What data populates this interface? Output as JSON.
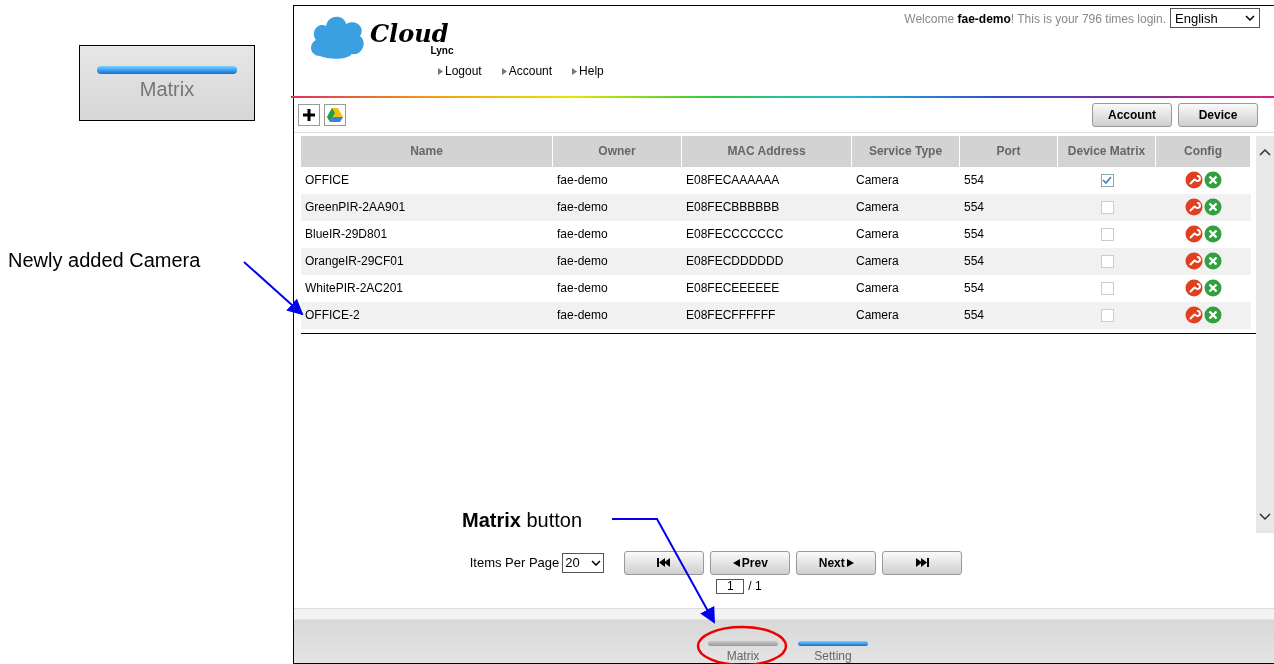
{
  "inset": {
    "label": "Matrix",
    "lit": true
  },
  "notes": {
    "new_camera": "Newly added Camera",
    "matrix": "**Matrix** button"
  },
  "header": {
    "welcome": "Welcome **fae-demo**! This is your 796 times login.",
    "language": "English",
    "logo": {
      "word": "Cloud",
      "sub": "Lync"
    },
    "nav": [
      "Logout",
      "Account",
      "Help"
    ]
  },
  "toolbar": {
    "buttons": [
      "Account",
      "Device"
    ]
  },
  "table": {
    "columns": [
      "Name",
      "Owner",
      "MAC Address",
      "Service Type",
      "Port",
      "Device Matrix",
      "Config"
    ],
    "rows": [
      {
        "name": "OFFICE",
        "owner": "fae-demo",
        "mac": "E08FECAAAAAA",
        "service_type": "Camera",
        "port": "554",
        "device_matrix": true
      },
      {
        "name": "GreenPIR-2AA901",
        "owner": "fae-demo",
        "mac": "E08FECBBBBBB",
        "service_type": "Camera",
        "port": "554",
        "device_matrix": false
      },
      {
        "name": "BlueIR-29D801",
        "owner": "fae-demo",
        "mac": "E08FECCCCCCC",
        "service_type": "Camera",
        "port": "554",
        "device_matrix": false
      },
      {
        "name": "OrangeIR-29CF01",
        "owner": "fae-demo",
        "mac": "E08FECDDDDDD",
        "service_type": "Camera",
        "port": "554",
        "device_matrix": false
      },
      {
        "name": "WhitePIR-2AC201",
        "owner": "fae-demo",
        "mac": "E08FECEEEEEE",
        "service_type": "Camera",
        "port": "554",
        "device_matrix": false
      },
      {
        "name": "OFFICE-2",
        "owner": "fae-demo",
        "mac": "E08FECFFFFFF",
        "service_type": "Camera",
        "port": "554",
        "device_matrix": false
      }
    ]
  },
  "pagination": {
    "items_per_page_label": "Items Per Page",
    "items_per_page": "20",
    "buttons": [
      {
        "kind": "first"
      },
      {
        "kind": "prev",
        "label": "Prev"
      },
      {
        "kind": "next",
        "label": "Next"
      },
      {
        "kind": "last"
      }
    ],
    "page": "1",
    "total": "/ 1"
  },
  "footer_tabs": [
    {
      "label": "Matrix",
      "selected": false
    },
    {
      "label": "Setting",
      "selected": true
    }
  ]
}
